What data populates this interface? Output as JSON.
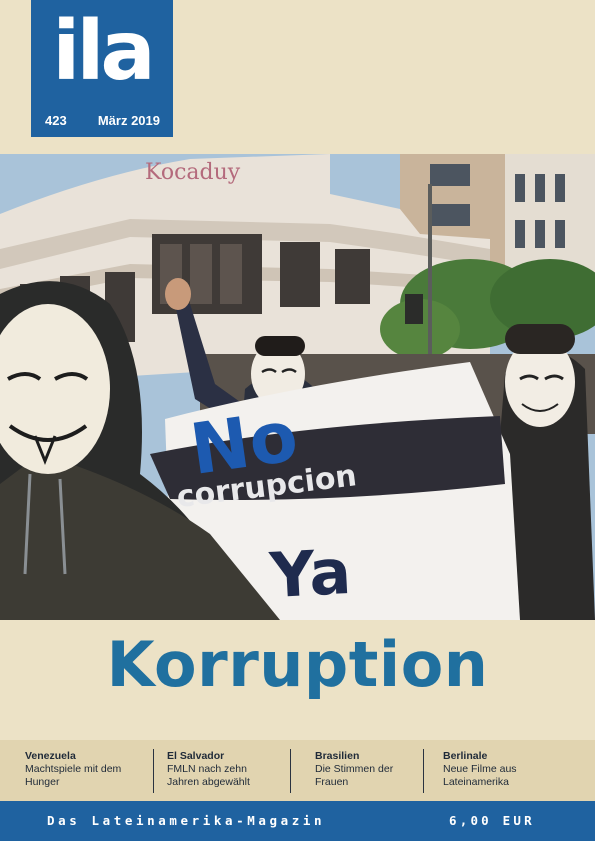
{
  "masthead": {
    "logo": "ila",
    "issue_number": "423",
    "issue_date": "März 2019"
  },
  "photo": {
    "building_sign": "Kocaduy",
    "banner_line1": "No",
    "banner_line2": "corrupcion",
    "banner_line3": "Ya"
  },
  "headline": "Korruption",
  "teasers": [
    {
      "title": "Venezuela",
      "subtitle": "Machtspiele mit dem Hunger"
    },
    {
      "title": "El Salvador",
      "subtitle": "FMLN nach zehn Jahren abgewählt"
    },
    {
      "title": "Brasilien",
      "subtitle": "Die Stimmen der Frauen"
    },
    {
      "title": "Berlinale",
      "subtitle": "Neue Filme aus Lateinamerika"
    }
  ],
  "footer": {
    "tagline": "Das Lateinamerika-Magazin",
    "price": "6,00 EUR"
  },
  "colors": {
    "brand_blue": "#1f62a0",
    "headline_blue": "#20709f",
    "background": "#ece2c6",
    "teaser_band": "#e1d4b0"
  }
}
